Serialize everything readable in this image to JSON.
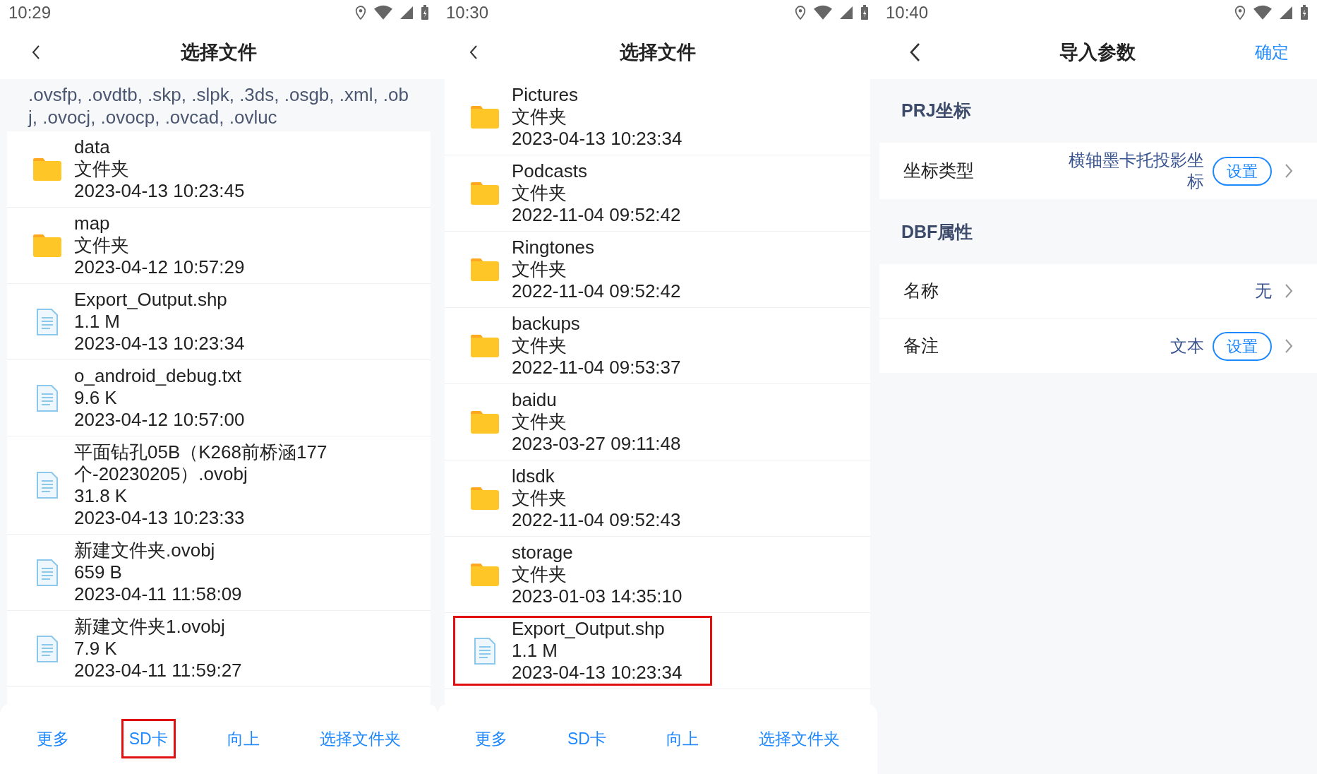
{
  "screens": [
    {
      "kind": "file_picker",
      "status_bar": {
        "time": "10:29"
      },
      "header": {
        "title": "选择文件"
      },
      "notice": ".ovsfp, .ovdtb, .skp, .slpk, .3ds, .osgb, .xml, .obj, .ovocj, .ovocp, .ovcad, .ovluc",
      "items": [
        {
          "kind": "folder",
          "name": "data",
          "detail": "文件夹",
          "date": "2023-04-13 10:23:45",
          "highlighted": false
        },
        {
          "kind": "folder",
          "name": "map",
          "detail": "文件夹",
          "date": "2023-04-12 10:57:29",
          "highlighted": false
        },
        {
          "kind": "file",
          "name": "Export_Output.shp",
          "detail": "1.1 M",
          "date": "2023-04-13 10:23:34",
          "highlighted": false
        },
        {
          "kind": "file",
          "name": "o_android_debug.txt",
          "detail": "9.6 K",
          "date": "2023-04-12 10:57:00",
          "highlighted": false
        },
        {
          "kind": "file",
          "name": "平面钻孔05B（K268前桥涵177个-20230205）.ovobj",
          "detail": "31.8 K",
          "date": "2023-04-13 10:23:33",
          "highlighted": false
        },
        {
          "kind": "file",
          "name": "新建文件夹.ovobj",
          "detail": "659 B",
          "date": "2023-04-11 11:58:09",
          "highlighted": false
        },
        {
          "kind": "file",
          "name": "新建文件夹1.ovobj",
          "detail": "7.9 K",
          "date": "2023-04-11 11:59:27",
          "highlighted": false
        }
      ],
      "bottom_bar": [
        {
          "label": "更多",
          "highlighted": false
        },
        {
          "label": "SD卡",
          "highlighted": true
        },
        {
          "label": "向上",
          "highlighted": false
        },
        {
          "label": "选择文件夹",
          "highlighted": false
        }
      ]
    },
    {
      "kind": "file_picker",
      "status_bar": {
        "time": "10:30"
      },
      "header": {
        "title": "选择文件"
      },
      "items": [
        {
          "kind": "folder",
          "name": "Pictures",
          "detail": "文件夹",
          "date": "2023-04-13 10:23:34",
          "highlighted": false
        },
        {
          "kind": "folder",
          "name": "Podcasts",
          "detail": "文件夹",
          "date": "2022-11-04 09:52:42",
          "highlighted": false
        },
        {
          "kind": "folder",
          "name": "Ringtones",
          "detail": "文件夹",
          "date": "2022-11-04 09:52:42",
          "highlighted": false
        },
        {
          "kind": "folder",
          "name": "backups",
          "detail": "文件夹",
          "date": "2022-11-04 09:53:37",
          "highlighted": false
        },
        {
          "kind": "folder",
          "name": "baidu",
          "detail": "文件夹",
          "date": "2023-03-27 09:11:48",
          "highlighted": false
        },
        {
          "kind": "folder",
          "name": "ldsdk",
          "detail": "文件夹",
          "date": "2022-11-04 09:52:43",
          "highlighted": false
        },
        {
          "kind": "folder",
          "name": "storage",
          "detail": "文件夹",
          "date": "2023-01-03 14:35:10",
          "highlighted": false
        },
        {
          "kind": "file",
          "name": "Export_Output.shp",
          "detail": "1.1 M",
          "date": "2023-04-13 10:23:34",
          "highlighted": true
        }
      ],
      "bottom_bar": [
        {
          "label": "更多",
          "highlighted": false
        },
        {
          "label": "SD卡",
          "highlighted": false
        },
        {
          "label": "向上",
          "highlighted": false
        },
        {
          "label": "选择文件夹",
          "highlighted": false
        }
      ]
    },
    {
      "kind": "form",
      "status_bar": {
        "time": "10:40"
      },
      "header": {
        "title": "导入参数",
        "action": "确定"
      },
      "sections": [
        {
          "title": "PRJ坐标",
          "rows": [
            {
              "label": "坐标类型",
              "value": "横轴墨卡托投影坐标",
              "button": "设置"
            }
          ]
        },
        {
          "title": "DBF属性",
          "rows": [
            {
              "label": "名称",
              "value": "无"
            },
            {
              "label": "备注",
              "value": "文本",
              "button": "设置"
            }
          ]
        }
      ]
    }
  ]
}
